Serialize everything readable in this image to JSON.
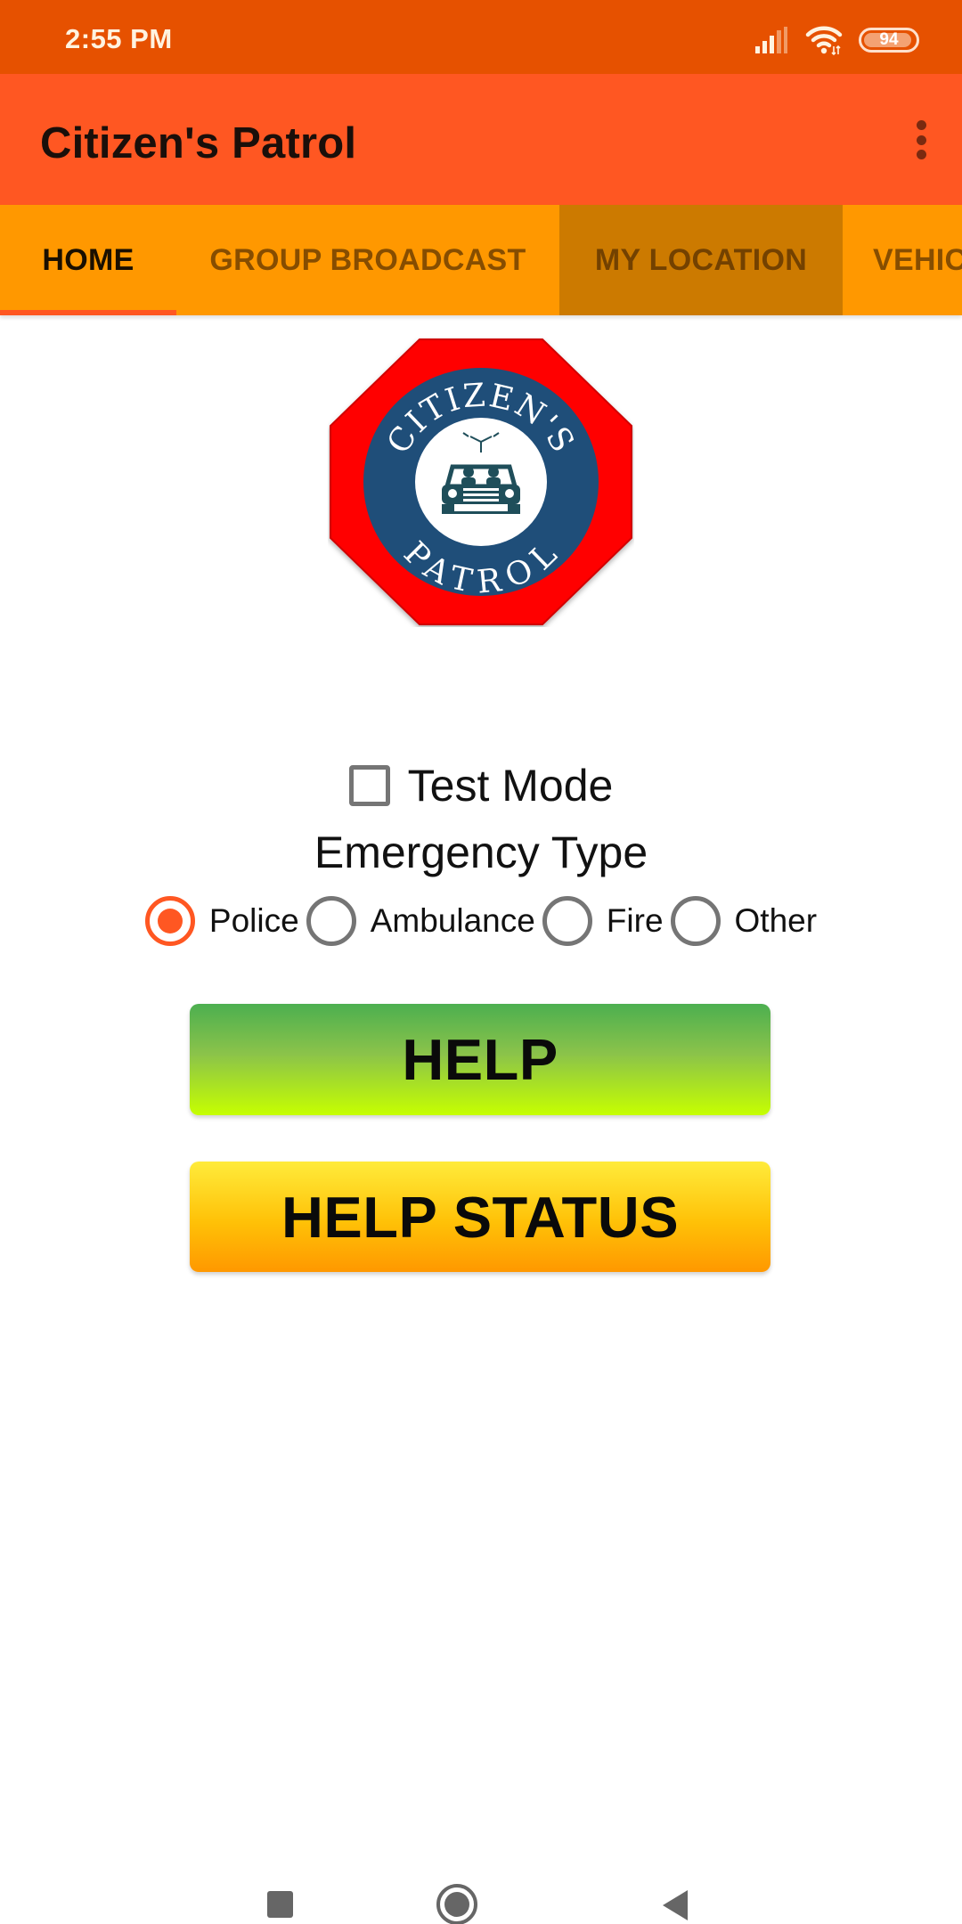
{
  "status_bar": {
    "time": "2:55 PM",
    "battery_level": "94",
    "battery_fraction": 0.94,
    "icons": [
      "signal-icon",
      "wifi-icon",
      "battery-icon"
    ]
  },
  "app_bar": {
    "title": "Citizen's Patrol",
    "menu_icon": "more-vertical-icon"
  },
  "tabs": [
    {
      "label": "HOME",
      "active": true
    },
    {
      "label": "GROUP BROADCAST",
      "active": false
    },
    {
      "label": "MY LOCATION",
      "active": false,
      "pressed": true
    },
    {
      "label": "VEHIC",
      "active": false
    }
  ],
  "logo": {
    "top_text": "CITIZEN'S",
    "bottom_text": "PATROL",
    "colors": {
      "octagon": "#FF0000",
      "ring": "#1F4E79",
      "center": "#FFFFFF",
      "car": "#1F4E5A"
    }
  },
  "test_mode": {
    "label": "Test Mode",
    "checked": false
  },
  "emergency": {
    "heading": "Emergency Type",
    "options": [
      {
        "label": "Police",
        "checked": true
      },
      {
        "label": "Ambulance",
        "checked": false
      },
      {
        "label": "Fire",
        "checked": false
      },
      {
        "label": "Other",
        "checked": false
      }
    ]
  },
  "buttons": {
    "help": "HELP",
    "help_status": "HELP STATUS"
  },
  "colors": {
    "status_bar": "#E65100",
    "app_bar": "#FF5722",
    "tab_bar": "#FF9800",
    "accent": "#FF5722"
  },
  "nav_bar": {
    "icons": [
      "recents-icon",
      "home-icon",
      "back-icon"
    ]
  }
}
